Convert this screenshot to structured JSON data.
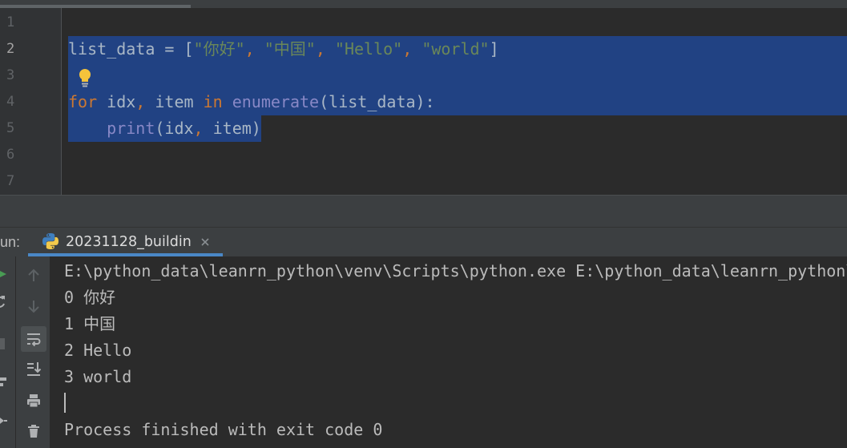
{
  "theme": {
    "editor_background": "#2B2B2B",
    "gutter_background": "#313335",
    "panel_background": "#3C3F41",
    "selection": "#214283",
    "code_text": "#A9B7C6",
    "keyword": "#CC7832",
    "string": "#6A8759",
    "builtin": "#8888C6",
    "line_number": "#606366",
    "console_text": "#BBBBBB",
    "active_tab_underline": "#4A88C7"
  },
  "editor": {
    "line_numbers": [
      "1",
      "2",
      "3",
      "4",
      "5",
      "6",
      "7"
    ],
    "lines": [
      [],
      [
        "list_data = [",
        "\"你好\"",
        ", ",
        "\"中国\"",
        ", ",
        "\"Hello\"",
        ", ",
        "\"world\"",
        "]"
      ],
      [],
      [
        "for",
        " idx",
        ",",
        " item ",
        "in",
        " enumerate",
        "(list_data):"
      ],
      [
        "print",
        "(idx",
        ",",
        " item)"
      ],
      [],
      []
    ],
    "intention_icon": "lightbulb-icon"
  },
  "run_panel": {
    "title": "un:",
    "tab": {
      "icon": "python-icon",
      "label": "20231128_buildin",
      "close_icon": "close-icon"
    },
    "left_toolbar_icons": [
      "run-icon",
      "rerun-icon",
      "stop-icon",
      "layout-icon",
      "pin-icon"
    ],
    "right_toolbar_icons": [
      "up-arrow-icon",
      "down-arrow-icon",
      "soft-wrap-icon",
      "scroll-to-end-icon",
      "print-icon",
      "trash-icon"
    ],
    "console_lines": [
      "E:\\python_data\\leanrn_python\\venv\\Scripts\\python.exe E:\\python_data\\leanrn_python\\",
      "0 你好",
      "1 中国",
      "2 Hello",
      "3 world"
    ],
    "exit_message": "Process finished with exit code 0"
  }
}
